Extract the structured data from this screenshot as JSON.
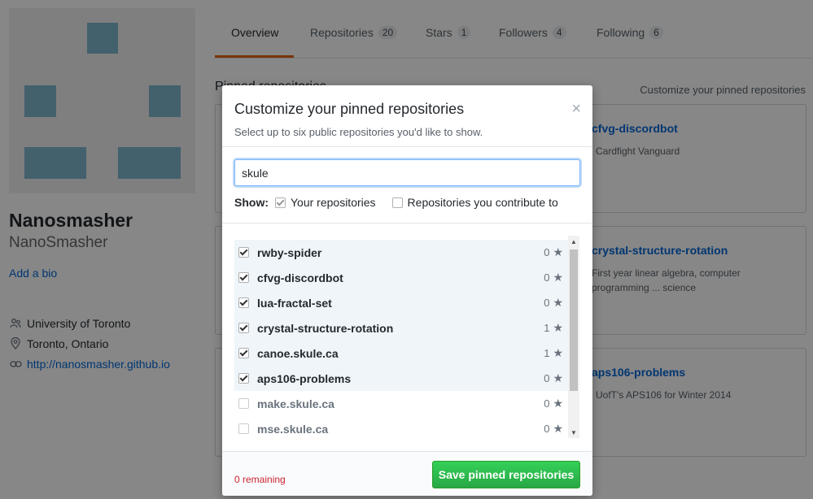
{
  "profile": {
    "name": "Nanosmasher",
    "login": "NanoSmasher",
    "add_bio": "Add a bio",
    "organization": "University of Toronto",
    "location": "Toronto, Ontario",
    "website": "http://nanosmasher.github.io"
  },
  "tabs": [
    {
      "label": "Overview",
      "count": ""
    },
    {
      "label": "Repositories",
      "count": "20"
    },
    {
      "label": "Stars",
      "count": "1"
    },
    {
      "label": "Followers",
      "count": "4"
    },
    {
      "label": "Following",
      "count": "6"
    }
  ],
  "pinned": {
    "title": "Pinned repositories",
    "customize_link": "Customize your pinned repositories",
    "cards": [
      {
        "name": "cfvg-discordbot",
        "desc": "Cardfight Vanguard"
      },
      {
        "name": "crystal-structure-rotation",
        "desc": "First year linear algebra, computer programming ... science"
      },
      {
        "name": "aps106-problems",
        "desc": "UofT's APS106 for Winter 2014"
      }
    ]
  },
  "modal": {
    "title": "Customize your pinned repositories",
    "subtitle": "Select up to six public repositories you'd like to show.",
    "close": "×",
    "filter_value": "skule",
    "show_label": "Show:",
    "show_own": "Your repositories",
    "show_contrib": "Repositories you contribute to",
    "repos": [
      {
        "name": "rwby-spider",
        "stars": "0",
        "checked": true
      },
      {
        "name": "cfvg-discordbot",
        "stars": "0",
        "checked": true
      },
      {
        "name": "lua-fractal-set",
        "stars": "0",
        "checked": true
      },
      {
        "name": "crystal-structure-rotation",
        "stars": "1",
        "checked": true
      },
      {
        "name": "canoe.skule.ca",
        "stars": "1",
        "checked": true
      },
      {
        "name": "aps106-problems",
        "stars": "0",
        "checked": true
      },
      {
        "name": "make.skule.ca",
        "stars": "0",
        "checked": false
      },
      {
        "name": "mse.skule.ca",
        "stars": "0",
        "checked": false
      }
    ],
    "remaining": "0 remaining",
    "save_label": "Save pinned repositories"
  },
  "colors": {
    "accent_link": "#0366d6",
    "tab_underline": "#e36209",
    "save_button": "#28a745",
    "remaining_text": "#cb2431",
    "identicon": "#7fb6cf"
  }
}
